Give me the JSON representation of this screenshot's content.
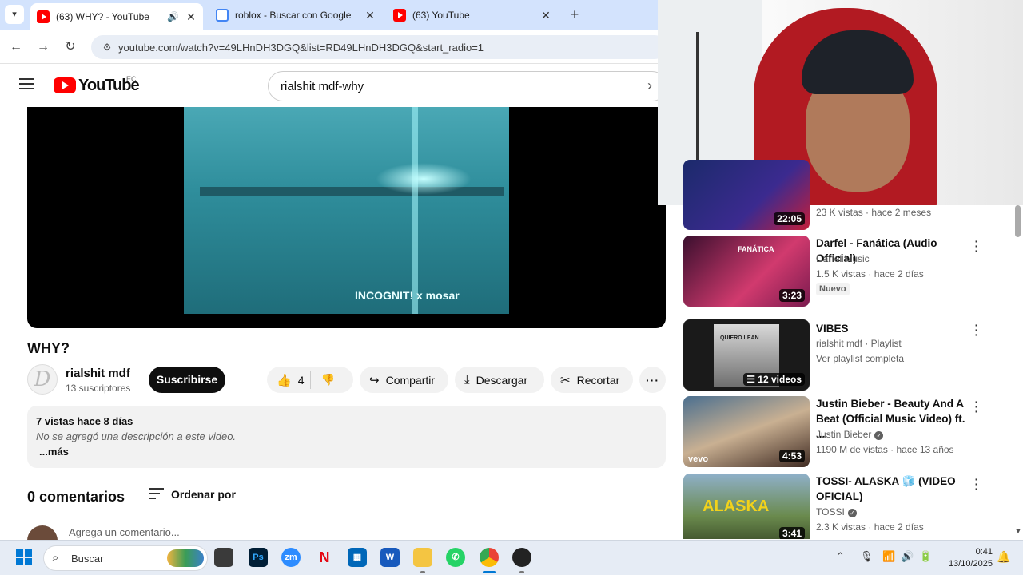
{
  "browser": {
    "tabs": [
      {
        "title": "(63) WHY? - YouTube",
        "icon": "youtube-favicon",
        "playing_audio": true,
        "active": true
      },
      {
        "title": "roblox - Buscar con Google",
        "icon": "google-favicon",
        "active": false
      },
      {
        "title": "(63) YouTube",
        "icon": "youtube-favicon",
        "active": false
      }
    ],
    "url": "youtube.com/watch?v=49LHnDH3DGQ&list=RD49LHnDH3DGQ&start_radio=1"
  },
  "yt": {
    "wordmark": "YouTube",
    "region": "EC",
    "search_value": "rialshit mdf-why"
  },
  "video": {
    "artist_text": "INCOGNIT! x mosar",
    "title": "WHY?",
    "channel": "rialshit mdf",
    "subscribers": "13 suscriptores",
    "subscribe_label": "Suscribirse",
    "likes": "4",
    "share_label": "Compartir",
    "download_label": "Descargar",
    "clip_label": "Recortar",
    "more_label": "···",
    "views_date": "7 vistas  hace 8 días",
    "no_description": "No se agregó una descripción a este video.",
    "more_link": "...más",
    "comments_count": "0 comentarios",
    "sort_label": "Ordenar por",
    "comment_placeholder": "Agrega un comentario..."
  },
  "recommendations": [
    {
      "title": "",
      "channel": "",
      "meta": "23 K vistas · hace 2 meses",
      "duration": "22:05"
    },
    {
      "title": "Darfel - Fanática (Audio Official)",
      "channel": "Darfel Music",
      "meta": "1.5 K vistas · hace 2 días",
      "badge": "Nuevo",
      "duration": "3:23",
      "thumb_text": "FANÁTICA"
    },
    {
      "title": "VIBES",
      "channel": "rialshit mdf · Playlist",
      "meta": "Ver playlist completa",
      "duration": "12 videos",
      "thumb_text": "QUIERO LEAN"
    },
    {
      "title": "Justin Bieber - Beauty And A Beat (Official Music Video) ft. ...",
      "channel": "Justin Bieber",
      "meta": "1190 M de vistas · hace 13 años",
      "duration": "4:53",
      "thumb_text": "vevo",
      "verified": true
    },
    {
      "title": "TOSSI- ALASKA 🧊 (VIDEO OFICIAL)",
      "channel": "TOSSI",
      "meta": "2.3 K vistas · hace 2 días",
      "duration": "3:41",
      "thumb_text": "ALASKA",
      "verified": true
    }
  ],
  "taskbar": {
    "search_placeholder": "Buscar",
    "time": "0:41",
    "date": "13/10/2025"
  }
}
